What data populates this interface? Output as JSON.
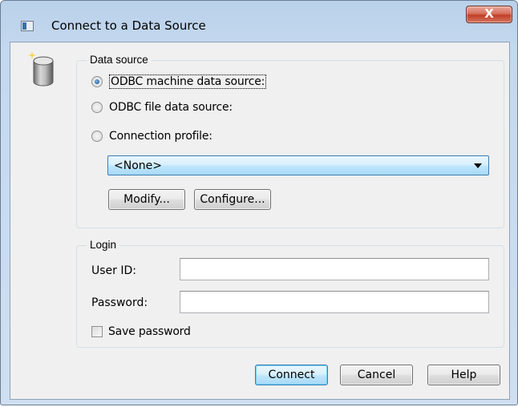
{
  "window": {
    "title": "Connect to a Data Source",
    "close_label": "X"
  },
  "data_source": {
    "legend": "Data source",
    "options": [
      {
        "label": "ODBC machine data source:",
        "checked": true
      },
      {
        "label": "ODBC file data source:",
        "checked": false
      },
      {
        "label": "Connection profile:",
        "checked": false
      }
    ],
    "profile_selected": "<None>",
    "modify_label": "Modify...",
    "configure_label": "Configure..."
  },
  "login": {
    "legend": "Login",
    "user_id_label": "User ID:",
    "user_id_value": "",
    "password_label": "Password:",
    "password_value": "",
    "save_password_label": "Save password",
    "save_password_checked": false
  },
  "buttons": {
    "connect": "Connect",
    "cancel": "Cancel",
    "help": "Help"
  },
  "icons": {
    "window": "window-icon",
    "database": "database-icon",
    "dropdown": "chevron-down-icon"
  },
  "colors": {
    "accent": "#3c7fb1",
    "close": "#c13f28",
    "window_frame": "#b9d1ea",
    "dialog_bg": "#f0f0f0"
  }
}
